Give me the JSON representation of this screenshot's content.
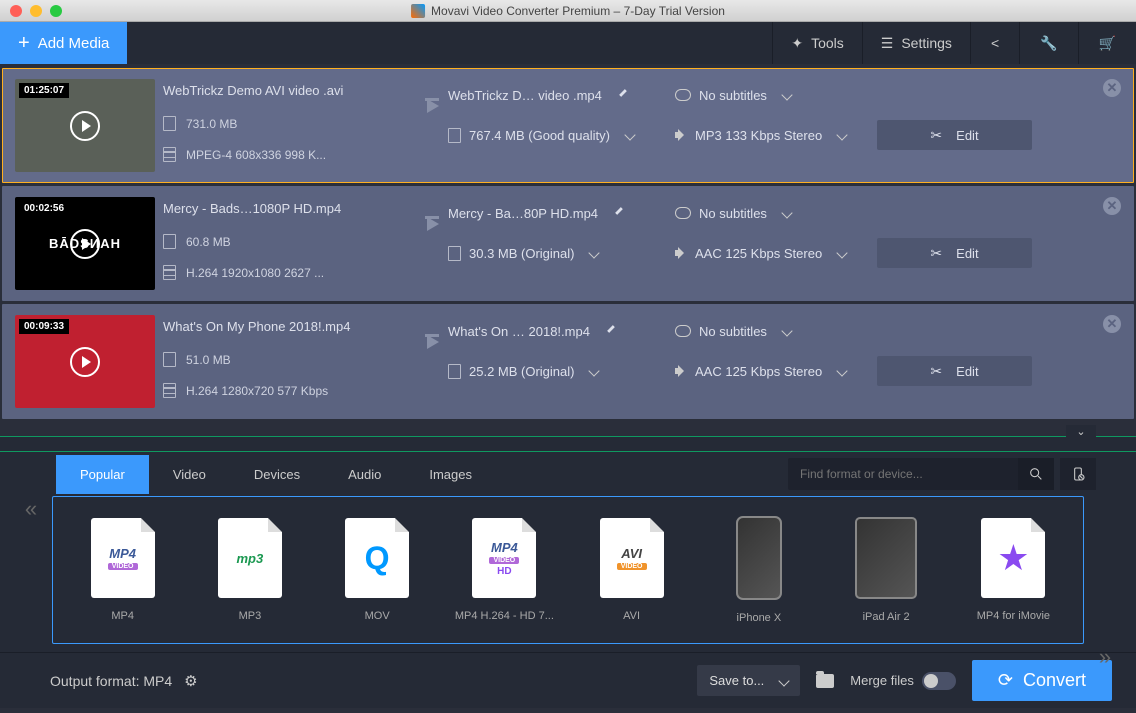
{
  "window_title": "Movavi Video Converter Premium – 7-Day Trial Version",
  "toolbar": {
    "add_media": "Add Media",
    "tools": "Tools",
    "settings": "Settings"
  },
  "files": [
    {
      "duration": "01:25:07",
      "src_name": "WebTrickz Demo AVI video .avi",
      "src_size": "731.0 MB",
      "src_codec": "MPEG-4 608x336 998 K...",
      "thumb_style": "grey",
      "thumb_text": "",
      "dst_name": "WebTrickz D… video .mp4",
      "dst_size": "767.4 MB (Good quality)",
      "subtitles": "No subtitles",
      "audio": "MP3 133 Kbps Stereo",
      "edit": "Edit",
      "selected": true
    },
    {
      "duration": "00:02:56",
      "src_name": "Mercy - Bads…1080P HD.mp4",
      "src_size": "60.8 MB",
      "src_codec": "H.264 1920x1080 2627 ...",
      "thumb_style": "black",
      "thumb_text": "BĀDSИAH",
      "dst_name": "Mercy - Ba…80P HD.mp4",
      "dst_size": "30.3 MB (Original)",
      "subtitles": "No subtitles",
      "audio": "AAC 125 Kbps Stereo",
      "edit": "Edit",
      "selected": false
    },
    {
      "duration": "00:09:33",
      "src_name": "What's On My Phone 2018!.mp4",
      "src_size": "51.0 MB",
      "src_codec": "H.264 1280x720 577 Kbps",
      "thumb_style": "red",
      "thumb_text": "",
      "dst_name": "What's On … 2018!.mp4",
      "dst_size": "25.2 MB (Original)",
      "subtitles": "No subtitles",
      "audio": "AAC 125 Kbps Stereo",
      "edit": "Edit",
      "selected": false
    }
  ],
  "format_tabs": [
    "Popular",
    "Video",
    "Devices",
    "Audio",
    "Images"
  ],
  "active_format_tab": 0,
  "search_placeholder": "Find format or device...",
  "formats": [
    {
      "label": "MP4",
      "kind": "mp4"
    },
    {
      "label": "MP3",
      "kind": "mp3"
    },
    {
      "label": "MOV",
      "kind": "mov"
    },
    {
      "label": "MP4 H.264 - HD 7...",
      "kind": "mp4hd"
    },
    {
      "label": "AVI",
      "kind": "avi"
    },
    {
      "label": "iPhone X",
      "kind": "iphone"
    },
    {
      "label": "iPad Air 2",
      "kind": "ipad"
    },
    {
      "label": "MP4 for iMovie",
      "kind": "imovie"
    }
  ],
  "bottom": {
    "output_format_label": "Output format: MP4",
    "save_to": "Save to...",
    "merge_files": "Merge files",
    "convert": "Convert"
  }
}
